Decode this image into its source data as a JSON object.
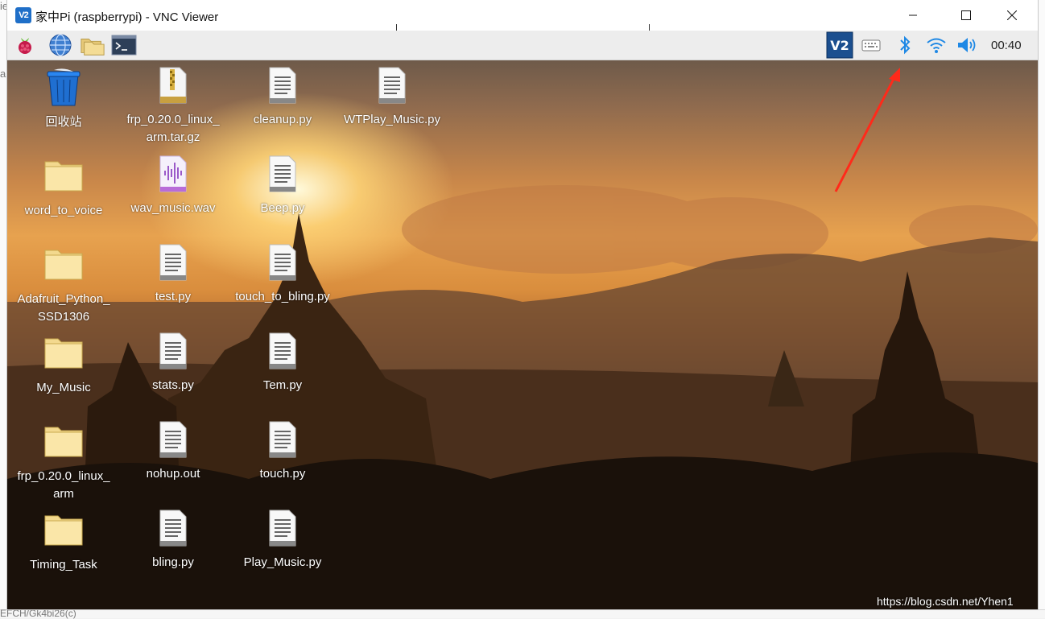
{
  "window": {
    "title": "家中Pi (raspberrypi) - VNC Viewer",
    "app_icon_text": "V2",
    "controls": {
      "minimize": "—",
      "maximize": "☐",
      "close": "✕"
    }
  },
  "taskbar": {
    "left_icons": [
      "raspberry-menu-icon",
      "web-browser-icon",
      "file-manager-icon",
      "terminal-icon"
    ],
    "right_icons": [
      "vnc-server-icon",
      "keyboard-icon",
      "bluetooth-icon",
      "wifi-icon",
      "volume-icon"
    ],
    "clock": "00:40",
    "accent_color": "#1e88e5"
  },
  "desktop": {
    "icons": [
      {
        "label": "回收站",
        "type": "trash"
      },
      {
        "label": "frp_0.20.0_linux_arm.tar.gz",
        "type": "archive"
      },
      {
        "label": "cleanup.py",
        "type": "file"
      },
      {
        "label": "WTPlay_Music.py",
        "type": "file"
      },
      {
        "label": "word_to_voice",
        "type": "folder"
      },
      {
        "label": "wav_music.wav",
        "type": "audio"
      },
      {
        "label": "Beep.py",
        "type": "file"
      },
      {
        "label": "Adafruit_Python_SSD1306",
        "type": "folder"
      },
      {
        "label": "test.py",
        "type": "file"
      },
      {
        "label": "touch_to_bling.py",
        "type": "file"
      },
      {
        "label": "My_Music",
        "type": "folder"
      },
      {
        "label": "stats.py",
        "type": "file"
      },
      {
        "label": "Tem.py",
        "type": "file"
      },
      {
        "label": "frp_0.20.0_linux_arm",
        "type": "folder"
      },
      {
        "label": "nohup.out",
        "type": "file"
      },
      {
        "label": "touch.py",
        "type": "file"
      },
      {
        "label": "Timing_Task",
        "type": "folder"
      },
      {
        "label": "bling.py",
        "type": "file"
      },
      {
        "label": "Play_Music.py",
        "type": "file"
      }
    ]
  },
  "annotation": {
    "arrow_color": "#ff2a1a"
  },
  "host": {
    "fragment_bottom": "EFCH/Gk4bi26(c)"
  },
  "watermark": "https://blog.csdn.net/Yhen1"
}
